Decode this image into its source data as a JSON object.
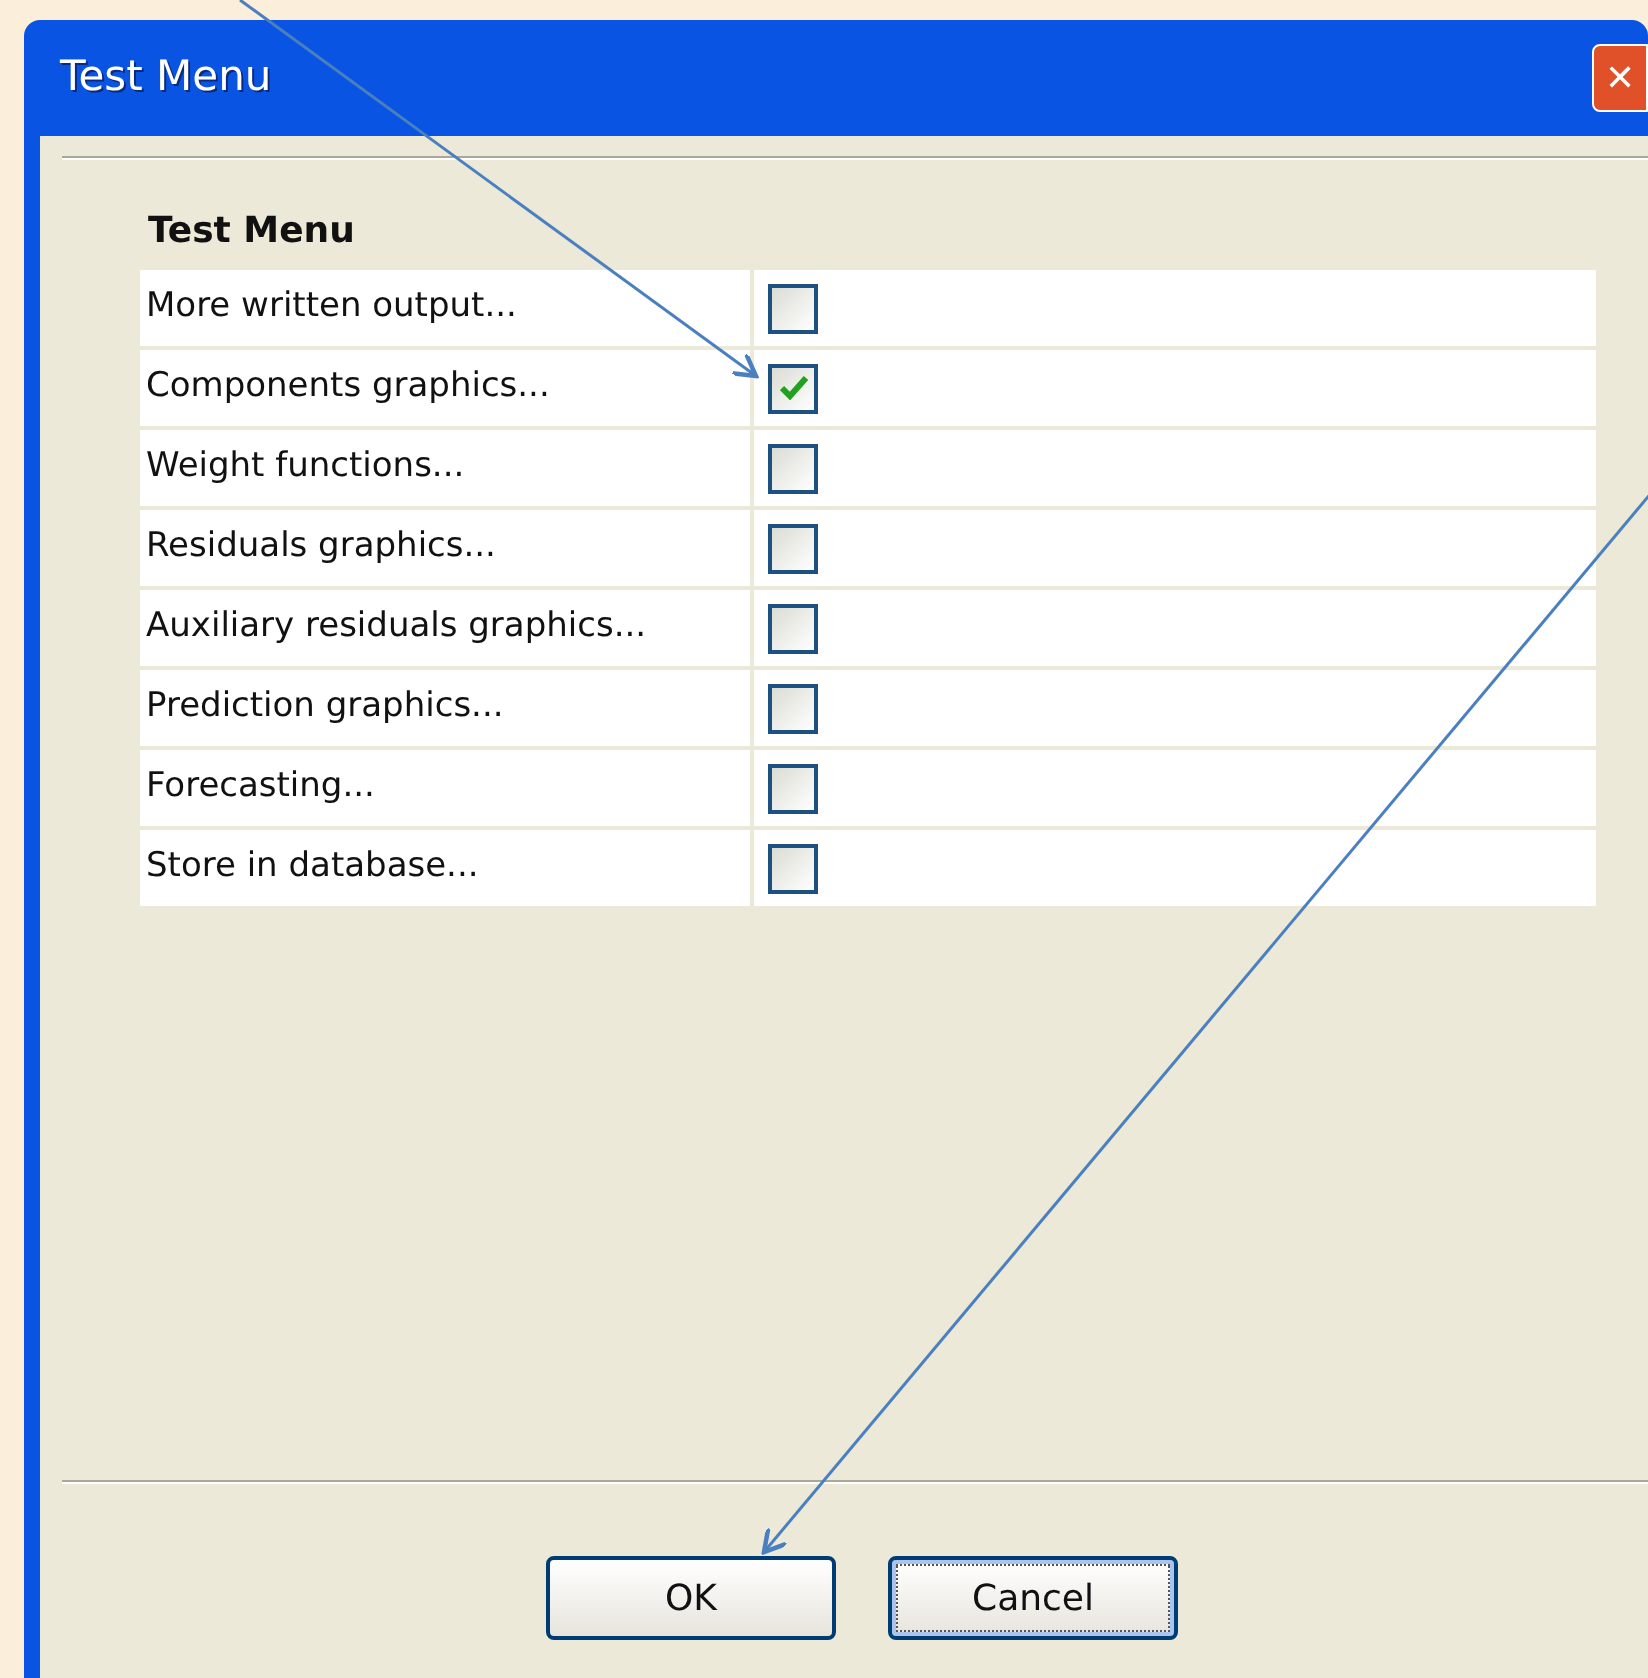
{
  "window": {
    "title": "Test Menu",
    "close": "✕"
  },
  "group_title": "Test Menu",
  "options": [
    {
      "label": "More written output...",
      "checked": false
    },
    {
      "label": "Components graphics...",
      "checked": true
    },
    {
      "label": "Weight functions...",
      "checked": false
    },
    {
      "label": "Residuals graphics...",
      "checked": false
    },
    {
      "label": "Auxiliary residuals graphics...",
      "checked": false
    },
    {
      "label": "Prediction graphics...",
      "checked": false
    },
    {
      "label": "Forecasting...",
      "checked": false
    },
    {
      "label": "Store in database...",
      "checked": false
    }
  ],
  "buttons": [
    {
      "label": "OK",
      "focused": false
    },
    {
      "label": "Cancel",
      "focused": true
    }
  ]
}
